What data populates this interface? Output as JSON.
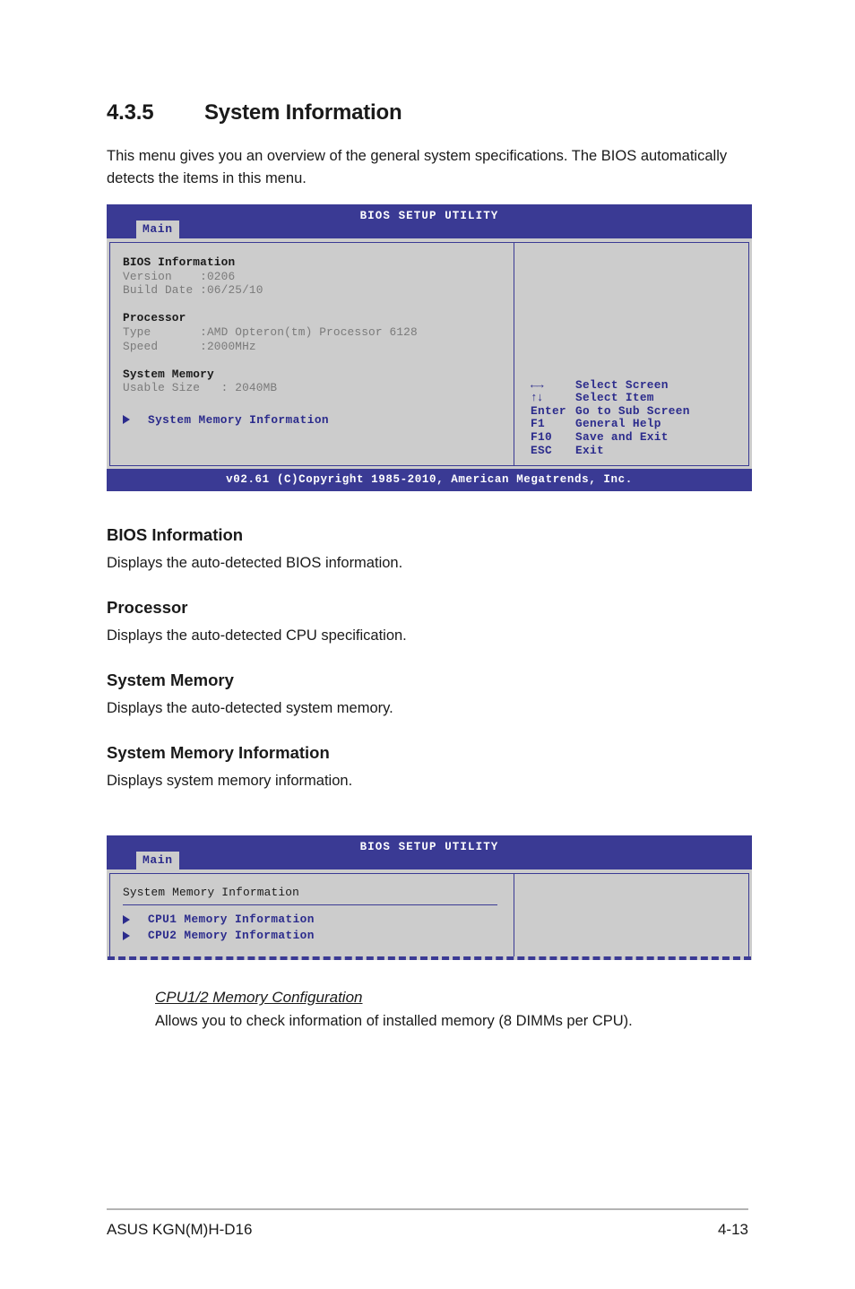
{
  "section": {
    "number": "4.3.5",
    "title": "System Information",
    "intro": "This menu gives you an overview of the general system specifications. The BIOS automatically detects the items in this menu."
  },
  "bios_screen_1": {
    "title": "BIOS SETUP UTILITY",
    "tab": "Main",
    "groups": [
      {
        "heading": "BIOS Information",
        "rows": [
          "Version    :0206",
          "Build Date :06/25/10"
        ]
      },
      {
        "heading": "Processor",
        "rows": [
          "Type       :AMD Opteron(tm) Processor 6128",
          "Speed      :2000MHz"
        ]
      },
      {
        "heading": "System Memory",
        "rows": [
          "Usable Size   : 2040MB"
        ]
      }
    ],
    "submenu_item": "System Memory Information",
    "nav_keys": [
      {
        "key": "←→",
        "desc": "Select Screen"
      },
      {
        "key": "↑↓",
        "desc": "Select Item"
      },
      {
        "key": "Enter",
        "desc": "Go to Sub Screen"
      },
      {
        "key": "F1",
        "desc": "General Help"
      },
      {
        "key": "F10",
        "desc": "Save and Exit"
      },
      {
        "key": "ESC",
        "desc": "Exit"
      }
    ],
    "footer": "v02.61 (C)Copyright 1985-2010, American Megatrends, Inc."
  },
  "descriptions": [
    {
      "heading": "BIOS Information",
      "text": "Displays the auto-detected BIOS information."
    },
    {
      "heading": "Processor",
      "text": "Displays the auto-detected CPU specification."
    },
    {
      "heading": "System Memory",
      "text": "Displays the auto-detected system memory."
    },
    {
      "heading": "System Memory Information",
      "text": "Displays system memory information."
    }
  ],
  "bios_screen_2": {
    "title": "BIOS SETUP UTILITY",
    "tab": "Main",
    "panel_title": "System Memory Information",
    "items": [
      "CPU1 Memory Information",
      "CPU2 Memory Information"
    ]
  },
  "subsection": {
    "heading": "CPU1/2 Memory Configuration",
    "text": "Allows you to check information of installed memory (8 DIMMs per CPU)."
  },
  "page_footer": {
    "product": "ASUS KGN(M)H-D16",
    "page_number": "4-13"
  },
  "colors": {
    "bios_blue": "#3a3a94",
    "bios_text_blue": "#2b2b8c",
    "bios_bg": "#cccccc"
  }
}
